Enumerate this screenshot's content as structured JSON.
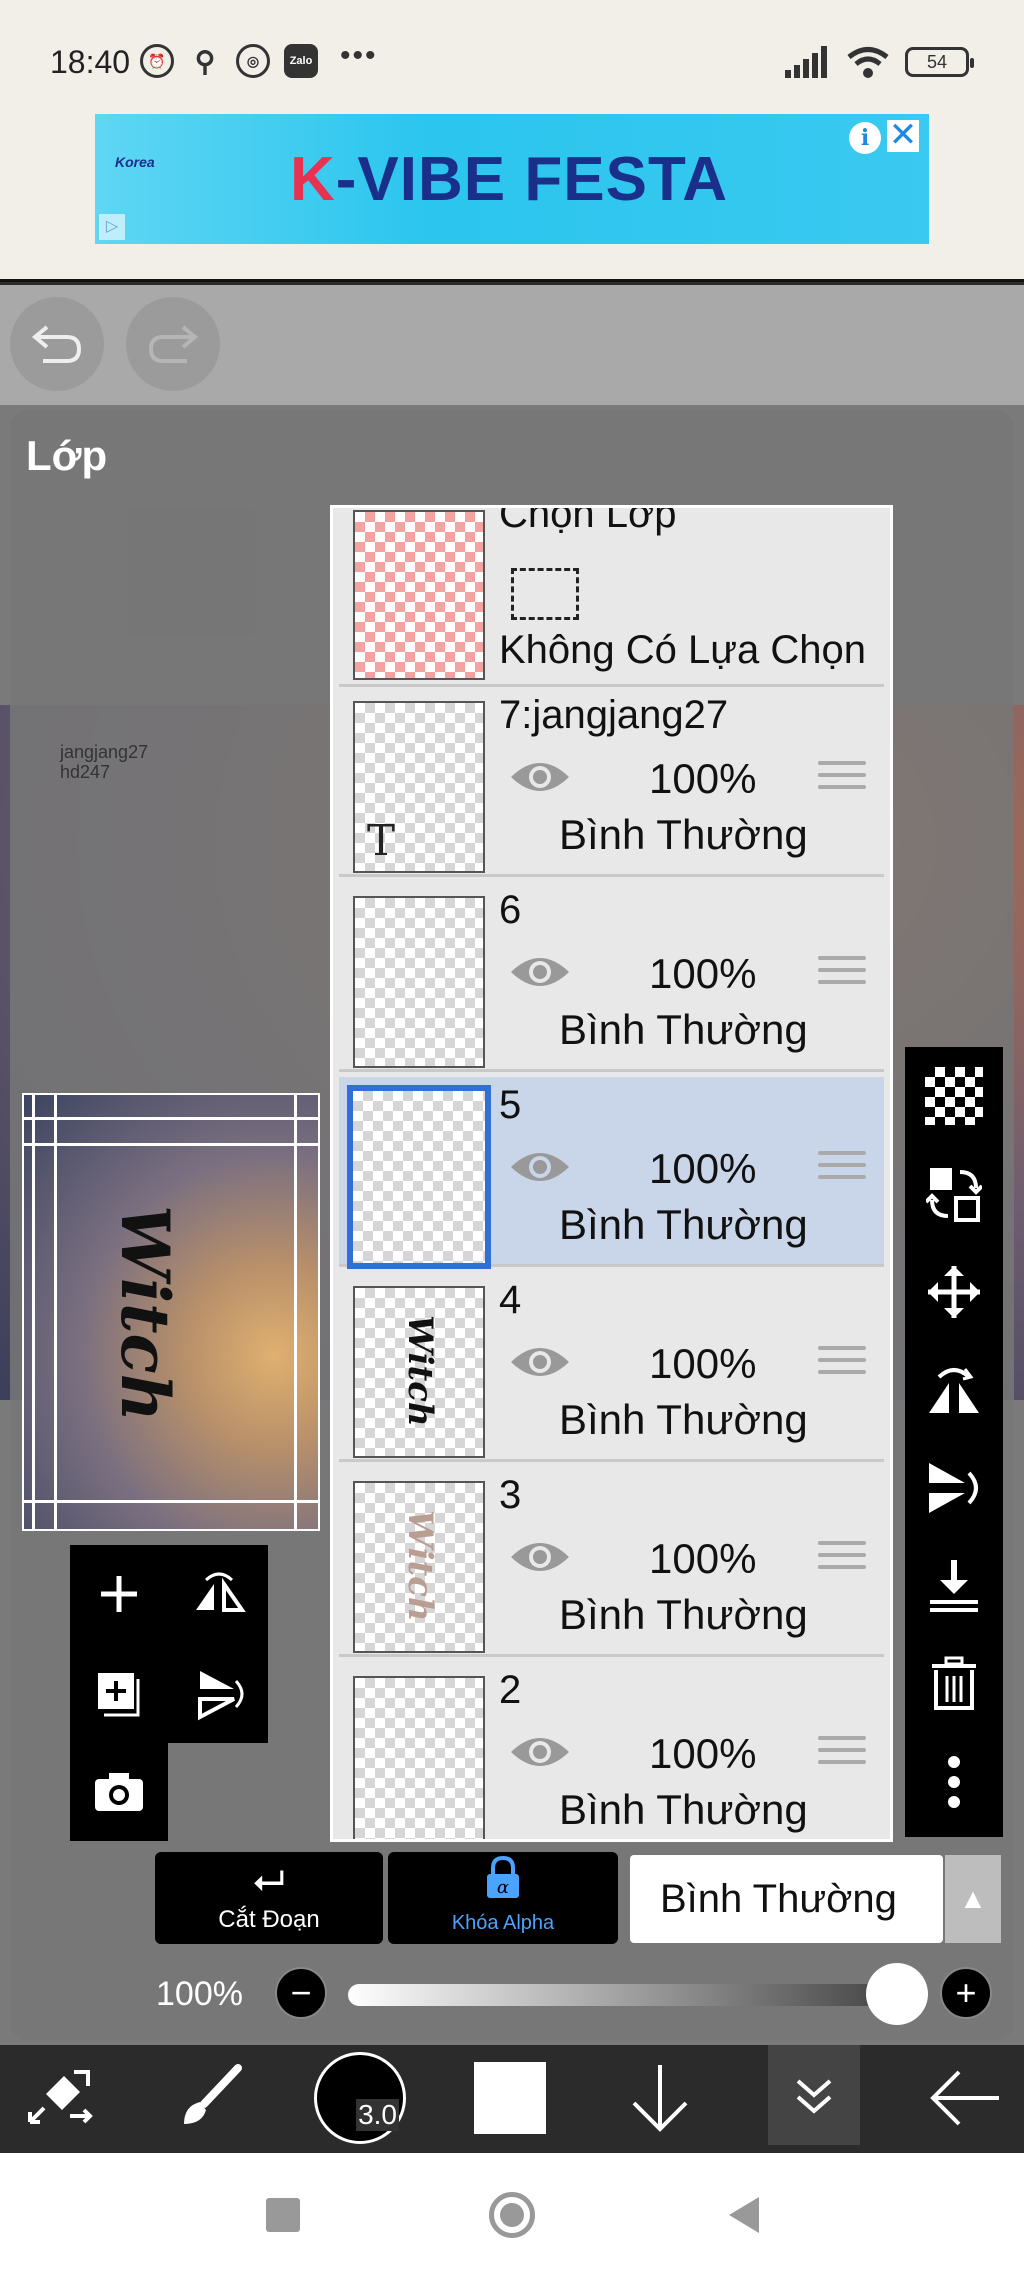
{
  "status_bar": {
    "time": "18:40",
    "app_icons": [
      "alarm-icon",
      "bike-icon",
      "compass-icon",
      "zalo-icon"
    ],
    "zalo_label": "Zalo",
    "more": "•••",
    "battery": "54"
  },
  "ad": {
    "title_k": "K",
    "title_rest": "-VIBE FESTA",
    "logo_text": "Korea",
    "info": "i",
    "close": "✕"
  },
  "panel": {
    "title": "Lớp",
    "watermark_line1": "jangjang27",
    "watermark_line2": "hd247"
  },
  "preview": {
    "word": "Witch"
  },
  "selection_layer": {
    "name": "Chọn Lớp",
    "status": "Không Có Lựa Chọn"
  },
  "layers": [
    {
      "name": "7:jangjang27",
      "opacity": "100%",
      "blend": "Bình Thường",
      "mark": "T",
      "selected": false
    },
    {
      "name": "6",
      "opacity": "100%",
      "blend": "Bình Thường",
      "selected": false
    },
    {
      "name": "5",
      "opacity": "100%",
      "blend": "Bình Thường",
      "selected": true
    },
    {
      "name": "4",
      "opacity": "100%",
      "blend": "Bình Thường",
      "mark": "Witch",
      "selected": false
    },
    {
      "name": "3",
      "opacity": "100%",
      "blend": "Bình Thường",
      "mark": "Witch",
      "selected": false
    },
    {
      "name": "2",
      "opacity": "100%",
      "blend": "Bình Thường",
      "selected": false
    }
  ],
  "controls": {
    "cut_label": "Cắt Đoạn",
    "alpha_label": "Khóa Alpha",
    "blend_mode": "Bình Thường",
    "opacity_value": "100%",
    "opacity_level": 1.0,
    "minus": "−",
    "plus": "+"
  },
  "toolbar": {
    "brush_size": "3.0",
    "current_color": "#ffffff"
  },
  "colors": {
    "selected_layer_bg": "#c9d6ea",
    "selected_border": "#2f6fd6",
    "alpha_accent": "#4ca3ff",
    "ad_brand": "#1a2f8a",
    "ad_accent": "#e63352"
  }
}
